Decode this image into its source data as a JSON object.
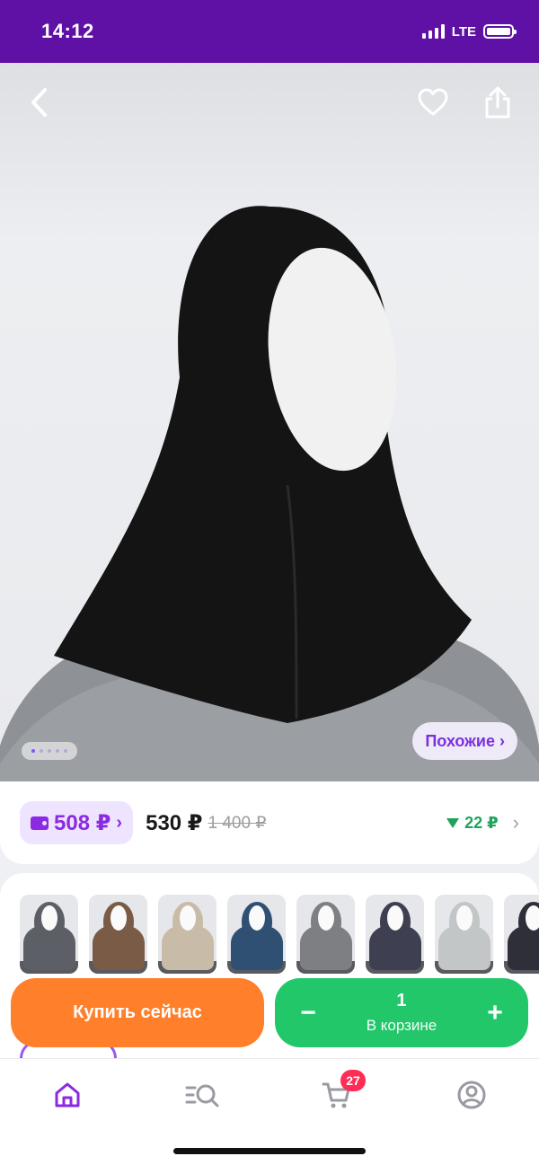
{
  "status_bar": {
    "time": "14:12",
    "network": "LTE"
  },
  "image_nav": {
    "back_icon": "chevron-left-icon",
    "favorite_icon": "heart-icon",
    "share_icon": "share-icon"
  },
  "gallery": {
    "similar_label": "Похожие ›",
    "dots_count": 5,
    "active_dot": 1
  },
  "price": {
    "wallet_price": "508 ₽",
    "wallet_chevron": "›",
    "current_price": "530 ₽",
    "old_price": "1 400 ₽",
    "drop_amount": "22 ₽",
    "chevron": "›"
  },
  "variants": {
    "colors": [
      "#5c6066",
      "#7a5b46",
      "#c8bba8",
      "#2f4f73",
      "#7d7f83",
      "#3f3f52",
      "#c2c6c6",
      "#2e2f39"
    ]
  },
  "actions": {
    "buy_now_label": "Купить сейчас",
    "minus_label": "−",
    "plus_label": "+",
    "cart_qty": "1",
    "cart_label": "В корзине"
  },
  "bottom_nav": {
    "cart_badge": "27"
  },
  "colors": {
    "brand_purple": "#5f11a6",
    "accent_purple": "#8a2be2",
    "buy_orange": "#ff7f2a",
    "cart_green": "#22c76a",
    "badge_red": "#ff2c55"
  }
}
